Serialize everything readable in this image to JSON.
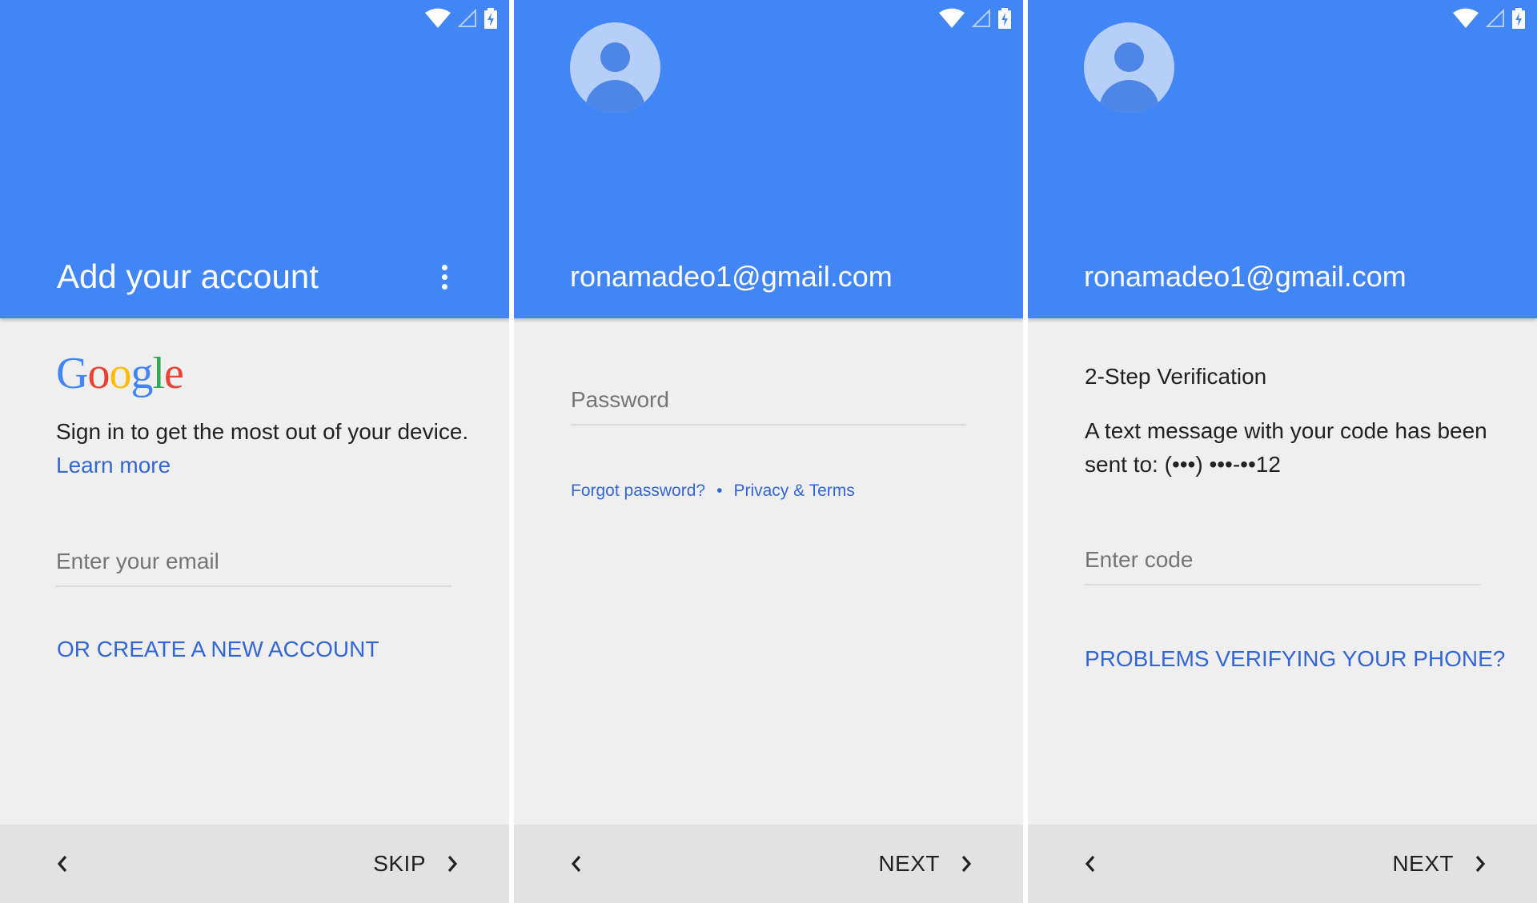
{
  "colors": {
    "header_blue": "#4285f4",
    "link_blue": "#3367d6",
    "background": "#efefef",
    "footer": "#e2e2e2"
  },
  "status_bar": {
    "icons": [
      "wifi-icon",
      "cell-signal-icon",
      "battery-charging-icon"
    ]
  },
  "screen1": {
    "title": "Add your account",
    "logo_letters": [
      {
        "char": "G",
        "color": "#4285f4"
      },
      {
        "char": "o",
        "color": "#ea4335"
      },
      {
        "char": "o",
        "color": "#fbbc05"
      },
      {
        "char": "g",
        "color": "#4285f4"
      },
      {
        "char": "l",
        "color": "#34a853"
      },
      {
        "char": "e",
        "color": "#ea4335"
      }
    ],
    "intro_text": "Sign in to get the most out of your device.",
    "learn_more": "Learn more",
    "email_placeholder": "Enter your email",
    "create_account": "OR CREATE A NEW ACCOUNT",
    "skip_label": "SKIP"
  },
  "screen2": {
    "email": "ronamadeo1@gmail.com",
    "password_placeholder": "Password",
    "forgot_password": "Forgot password?",
    "separator": "•",
    "privacy_terms": "Privacy & Terms",
    "next_label": "NEXT"
  },
  "screen3": {
    "email": "ronamadeo1@gmail.com",
    "heading": "2-Step Verification",
    "message": "A text message with your code has been sent to: (•••) •••-••12",
    "code_placeholder": "Enter code",
    "problems_link": "PROBLEMS VERIFYING YOUR PHONE?",
    "next_label": "NEXT"
  }
}
